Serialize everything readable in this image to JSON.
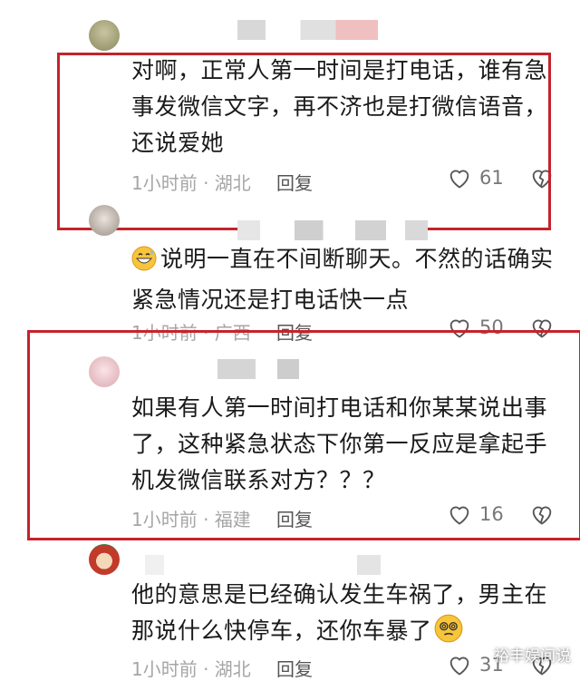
{
  "comments": [
    {
      "text": "对啊，正常人第一时间是打电话，谁有急事发微信文字，再不济也是打微信语音，还说爱她",
      "meta": "1小时前 · 湖北",
      "reply_label": "回复",
      "likes": "61"
    },
    {
      "text": "说明一直在不间断聊天。不然的话确实紧急情况还是打电话快一点",
      "meta": "1小时前 · 广西",
      "reply_label": "回复",
      "likes": "50"
    },
    {
      "text": "如果有人第一时间打电话和你某某说出事了，这种紧急状态下你第一反应是拿起手机发微信联系对方？？？",
      "meta": "1小时前 · 福建",
      "reply_label": "回复",
      "likes": "16"
    },
    {
      "text": "他的意思是已经确认发生车祸了，男主在那说什么快停车，还你车暴了",
      "meta": "1小时前 · 湖北",
      "reply_label": "回复",
      "likes": "31"
    }
  ],
  "watermark": "裕丰娱间说",
  "colors": {
    "highlight_border": "#c5232b",
    "meta_gray": "#a6a6a6"
  },
  "icons": [
    "heart-outline-icon",
    "broken-heart-icon",
    "grinning-sweat-emoji",
    "dizzy-face-emoji"
  ]
}
